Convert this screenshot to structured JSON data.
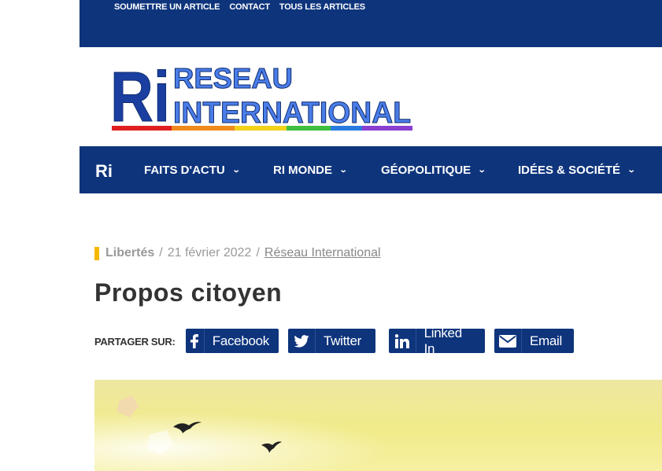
{
  "top_links": [
    "SOUMETTRE UN ARTICLE",
    "CONTACT",
    "TOUS LES ARTICLES"
  ],
  "logo": {
    "mark": "Ri",
    "line1": "RESEAU",
    "line2": "INTERNATIONAL"
  },
  "nav": [
    {
      "label": "FAITS D'ACTU"
    },
    {
      "label": "RI MONDE"
    },
    {
      "label": "GÉOPOLITIQUE"
    },
    {
      "label": "IDÉES & SOCIÉTÉ"
    }
  ],
  "nav_logo_mark": "Ri",
  "article": {
    "category": "Libertés",
    "date": "21 février 2022",
    "author": "Réseau International",
    "title": "Propos citoyen"
  },
  "share": {
    "label": "PARTAGER SUR:",
    "buttons": [
      {
        "label": "Facebook",
        "icon": "facebook-icon"
      },
      {
        "label": "Twitter",
        "icon": "twitter-icon"
      },
      {
        "label": "Linked In",
        "icon": "linkedin-icon"
      },
      {
        "label": "Email",
        "icon": "envelope-icon"
      }
    ]
  },
  "colors": {
    "brand": "#0e347c",
    "accent": "#f5b800"
  }
}
